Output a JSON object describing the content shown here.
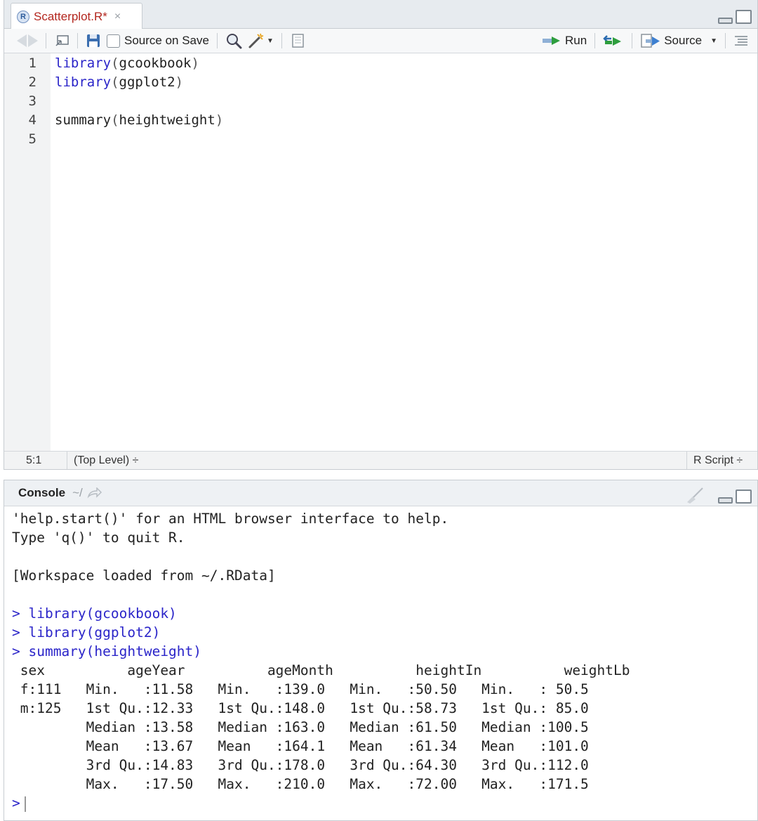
{
  "editor": {
    "tab": {
      "title": "Scatterplot.R*",
      "close": "×",
      "icon": "r-file-icon"
    },
    "toolbar": {
      "source_on_save_label": "Source on Save",
      "run_label": "Run",
      "source_label": "Source",
      "icons": [
        "back-arrow-icon",
        "forward-arrow-icon",
        "show-in-window-icon",
        "save-icon",
        "search-icon",
        "magic-wand-icon",
        "notebook-icon",
        "rerun-icon",
        "outline-icon"
      ]
    },
    "line_numbers": [
      "1",
      "2",
      "3",
      "4",
      "5"
    ],
    "code": [
      {
        "fn": "library",
        "open": "(",
        "arg": "gcookbook",
        "close": ")"
      },
      {
        "fn": "library",
        "open": "(",
        "arg": "ggplot2",
        "close": ")"
      },
      {
        "plain": ""
      },
      {
        "plain": "summary",
        "open": "(",
        "arg": "heightweight",
        "close": ")"
      },
      {
        "plain": ""
      }
    ],
    "status": {
      "cursor_pos": "5:1",
      "scope": "(Top Level) ÷",
      "file_type": "R Script ÷"
    }
  },
  "console": {
    "title": "Console",
    "path": "~/",
    "lines": [
      "'help.start()' for an HTML browser interface to help.",
      "Type 'q()' to quit R.",
      "",
      "[Workspace loaded from ~/.RData]",
      ""
    ],
    "commands": [
      "> library(gcookbook)",
      "> library(ggplot2)",
      "> summary(heightweight)"
    ],
    "summary_output": [
      " sex          ageYear          ageMonth          heightIn          weightLb    ",
      " f:111   Min.   :11.58   Min.   :139.0   Min.   :50.50   Min.   : 50.5  ",
      " m:125   1st Qu.:12.33   1st Qu.:148.0   1st Qu.:58.73   1st Qu.: 85.0  ",
      "         Median :13.58   Median :163.0   Median :61.50   Median :100.5  ",
      "         Mean   :13.67   Mean   :164.1   Mean   :61.34   Mean   :101.0  ",
      "         3rd Qu.:14.83   3rd Qu.:178.0   3rd Qu.:64.30   3rd Qu.:112.0  ",
      "         Max.   :17.50   Max.   :210.0   Max.   :72.00   Max.   :171.5  "
    ],
    "prompt": ">"
  },
  "colors": {
    "keyword": "#2b25c9",
    "tab_title": "#b3261e",
    "run_arrow": "#2e9e3e"
  }
}
